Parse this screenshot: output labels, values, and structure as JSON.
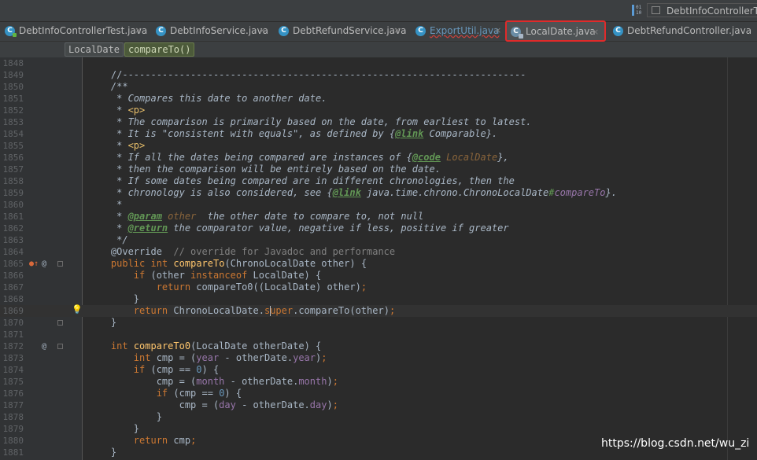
{
  "toolbar": {
    "run_config": "DebtInfoControllerTest",
    "run_icon_digits": "01\n10"
  },
  "tabs": [
    {
      "label": "DebtInfoControllerTest.java",
      "icon": "class-test-icon"
    },
    {
      "label": "DebtInfoService.java",
      "icon": "class-icon"
    },
    {
      "label": "DebtRefundService.java",
      "icon": "class-icon"
    },
    {
      "label": "ExportUtil.java",
      "icon": "class-icon"
    },
    {
      "label": "LocalDate.java",
      "icon": "library-class-icon"
    },
    {
      "label": "DebtRefundController.java",
      "icon": "class-icon"
    }
  ],
  "close_glyph": "×",
  "icon_letter": "C",
  "breadcrumb": {
    "class": "LocalDate",
    "method": "compareTo()"
  },
  "editor": {
    "lines": [
      {
        "n": "1848"
      },
      {
        "n": "1849",
        "t": "    //-----------------------------------------------------------------------"
      },
      {
        "n": "1850",
        "t": "    /**"
      },
      {
        "n": "1851",
        "t": "     * Compares this date to another date."
      },
      {
        "n": "1852",
        "t": "     * <p>"
      },
      {
        "n": "1853",
        "t": "     * The comparison is primarily based on the date, from earliest to latest."
      },
      {
        "n": "1854",
        "t": "     * It is \"consistent with equals\", as defined by {@link Comparable}."
      },
      {
        "n": "1855",
        "t": "     * <p>"
      },
      {
        "n": "1856",
        "t": "     * If all the dates being compared are instances of {@code LocalDate},"
      },
      {
        "n": "1857",
        "t": "     * then the comparison will be entirely based on the date."
      },
      {
        "n": "1858",
        "t": "     * If some dates being compared are in different chronologies, then the"
      },
      {
        "n": "1859",
        "t": "     * chronology is also considered, see {@link java.time.chrono.ChronoLocalDate#compareTo}."
      },
      {
        "n": "1860",
        "t": "     *"
      },
      {
        "n": "1861",
        "t": "     * @param other  the other date to compare to, not null"
      },
      {
        "n": "1862",
        "t": "     * @return the comparator value, negative if less, positive if greater"
      },
      {
        "n": "1863",
        "t": "     */"
      },
      {
        "n": "1864",
        "t": "    @Override  // override for Javadoc and performance"
      },
      {
        "n": "1865",
        "t": "    public int compareTo(ChronoLocalDate other) {"
      },
      {
        "n": "1866",
        "t": "        if (other instanceof LocalDate) {"
      },
      {
        "n": "1867",
        "t": "            return compareTo0((LocalDate) other);"
      },
      {
        "n": "1868",
        "t": "        }"
      },
      {
        "n": "1869",
        "t": "        return ChronoLocalDate.super.compareTo(other);"
      },
      {
        "n": "1870",
        "t": "    }"
      },
      {
        "n": "1871"
      },
      {
        "n": "1872",
        "t": "    int compareTo0(LocalDate otherDate) {"
      },
      {
        "n": "1873",
        "t": "        int cmp = (year - otherDate.year);"
      },
      {
        "n": "1874",
        "t": "        if (cmp == 0) {"
      },
      {
        "n": "1875",
        "t": "            cmp = (month - otherDate.month);"
      },
      {
        "n": "1876",
        "t": "            if (cmp == 0) {"
      },
      {
        "n": "1877",
        "t": "                cmp = (day - otherDate.day);"
      },
      {
        "n": "1878",
        "t": "            }"
      },
      {
        "n": "1879",
        "t": "        }"
      },
      {
        "n": "1880",
        "t": "        return cmp;"
      },
      {
        "n": "1881",
        "t": "    }"
      }
    ]
  },
  "gutter_marks": {
    "override": "●↑",
    "at": "@",
    "bulb": "💡"
  },
  "watermark": "https://blog.csdn.net/wu_zi"
}
